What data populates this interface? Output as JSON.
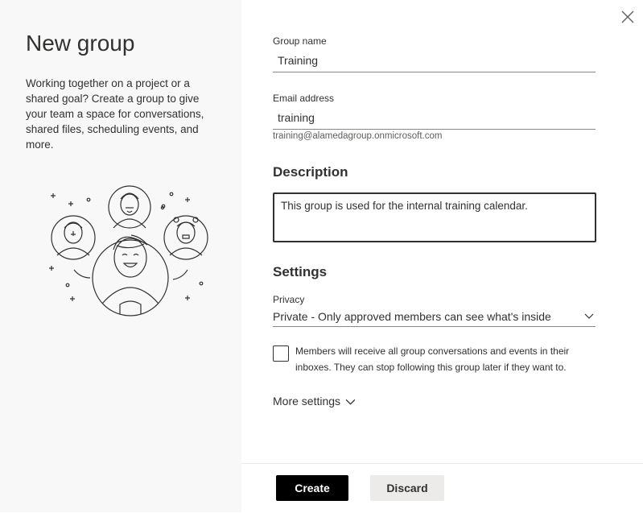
{
  "panel": {
    "title": "New group",
    "intro": "Working together on a project or a shared goal? Create a group to give your team a space for conversations, shared files, scheduling events, and more."
  },
  "form": {
    "group_name_label": "Group name",
    "group_name_value": "Training",
    "email_label": "Email address",
    "email_value": "training",
    "email_hint": "training@alamedagroup.onmicrosoft.com",
    "description_heading": "Description",
    "description_value": "This group is used for the internal training calendar.",
    "settings_heading": "Settings",
    "privacy_label": "Privacy",
    "privacy_value": "Private - Only approved members can see what's inside",
    "subscribe_checked": false,
    "subscribe_text": "Members will receive all group conversations and events in their inboxes. They can stop following this group later if they want to.",
    "more_settings_label": "More settings"
  },
  "footer": {
    "create_label": "Create",
    "discard_label": "Discard"
  },
  "icons": {
    "close": "close-icon",
    "chevron": "chevron-down-icon",
    "illustration": "people-group-illustration"
  }
}
